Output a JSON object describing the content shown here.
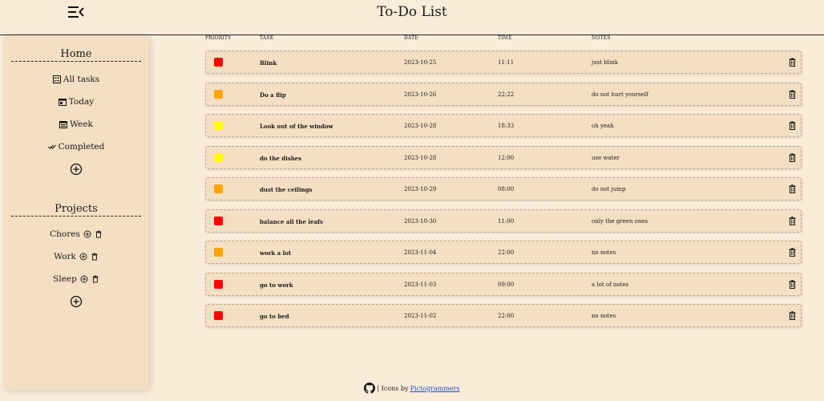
{
  "header": {
    "title": "To-Do List"
  },
  "sidebar": {
    "home_title": "Home",
    "home_items": [
      {
        "label": "All tasks",
        "icon": "list-icon"
      },
      {
        "label": "Today",
        "icon": "calendar-day-icon"
      },
      {
        "label": "Week",
        "icon": "calendar-week-icon"
      },
      {
        "label": "Completed",
        "icon": "double-check-icon"
      }
    ],
    "projects_title": "Projects",
    "projects": [
      {
        "label": "Chores"
      },
      {
        "label": "Work"
      },
      {
        "label": "Sleep"
      }
    ]
  },
  "table": {
    "columns": {
      "priority": "PRIORITY",
      "task": "TASK",
      "date": "DATE",
      "time": "TIME",
      "notes": "NOTES"
    },
    "rows": [
      {
        "priority": "high",
        "task": "Blink",
        "date": "2023-10-25",
        "time": "11:11",
        "notes": "just blink"
      },
      {
        "priority": "medium",
        "task": "Do a flip",
        "date": "2023-10-26",
        "time": "22:22",
        "notes": "do not hurt yourself"
      },
      {
        "priority": "low",
        "task": "Look out of the window",
        "date": "2023-10-28",
        "time": "18:33",
        "notes": "oh yeah"
      },
      {
        "priority": "low",
        "task": "do the dishes",
        "date": "2023-10-28",
        "time": "12:00",
        "notes": "use water"
      },
      {
        "priority": "medium",
        "task": "dust the ceilings",
        "date": "2023-10-29",
        "time": "08:00",
        "notes": "do not jump"
      },
      {
        "priority": "high",
        "task": "balance all the leafs",
        "date": "2023-10-30",
        "time": "11:00",
        "notes": "only the green ones"
      },
      {
        "priority": "medium",
        "task": "work a lot",
        "date": "2023-11-04",
        "time": "22:00",
        "notes": "no notes"
      },
      {
        "priority": "high",
        "task": "go to work",
        "date": "2023-11-03",
        "time": "09:00",
        "notes": "a lot of notes"
      },
      {
        "priority": "high",
        "task": "go to bed",
        "date": "2023-11-02",
        "time": "22:00",
        "notes": "no notes"
      }
    ]
  },
  "priority_colors": {
    "high": "#ff0000",
    "medium": "#ffa500",
    "low": "#ffff00"
  },
  "footer": {
    "prefix": "| Icons by",
    "link": "Pictogrammers"
  }
}
